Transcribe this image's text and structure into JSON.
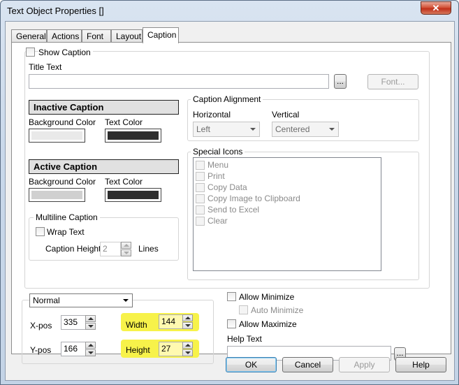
{
  "window": {
    "title": "Text Object Properties []",
    "close": "✕"
  },
  "tabs": [
    "General",
    "Actions",
    "Font",
    "Layout",
    "Caption"
  ],
  "caption": {
    "show_caption": "Show Caption",
    "title_text_label": "Title Text",
    "title_text_value": "",
    "ellipsis": "...",
    "font_button": "Font...",
    "inactive": {
      "header": "Inactive Caption",
      "bg_label": "Background Color",
      "text_label": "Text Color"
    },
    "active": {
      "header": "Active Caption",
      "bg_label": "Background Color",
      "text_label": "Text Color"
    },
    "colors": {
      "inactive_bg": "#e9e9e9",
      "inactive_text": "#2e2e2e",
      "active_bg": "#d0d0d0",
      "active_text": "#2e2e2e"
    },
    "alignment": {
      "title": "Caption Alignment",
      "horizontal_label": "Horizontal",
      "horizontal_value": "Left",
      "vertical_label": "Vertical",
      "vertical_value": "Centered"
    },
    "special_icons": {
      "title": "Special Icons",
      "items": [
        "Menu",
        "Print",
        "Copy Data",
        "Copy Image to Clipboard",
        "Send to Excel",
        "Clear"
      ]
    },
    "multiline": {
      "title": "Multiline Caption",
      "wrap_text": "Wrap Text",
      "height_label": "Caption Height",
      "height_value": "2",
      "lines_label": "Lines"
    }
  },
  "position": {
    "mode": "Normal",
    "xpos_label": "X-pos",
    "xpos": "335",
    "ypos_label": "Y-pos",
    "ypos": "166",
    "width_label": "Width",
    "width": "144",
    "height_label": "Height",
    "height": "27",
    "highlight_color": "#f7f24a"
  },
  "options": {
    "allow_minimize": "Allow Minimize",
    "auto_minimize": "Auto Minimize",
    "allow_maximize": "Allow Maximize",
    "help_text_label": "Help Text",
    "help_text_value": "",
    "ellipsis": "..."
  },
  "buttons": {
    "ok": "OK",
    "cancel": "Cancel",
    "apply": "Apply",
    "help": "Help"
  }
}
